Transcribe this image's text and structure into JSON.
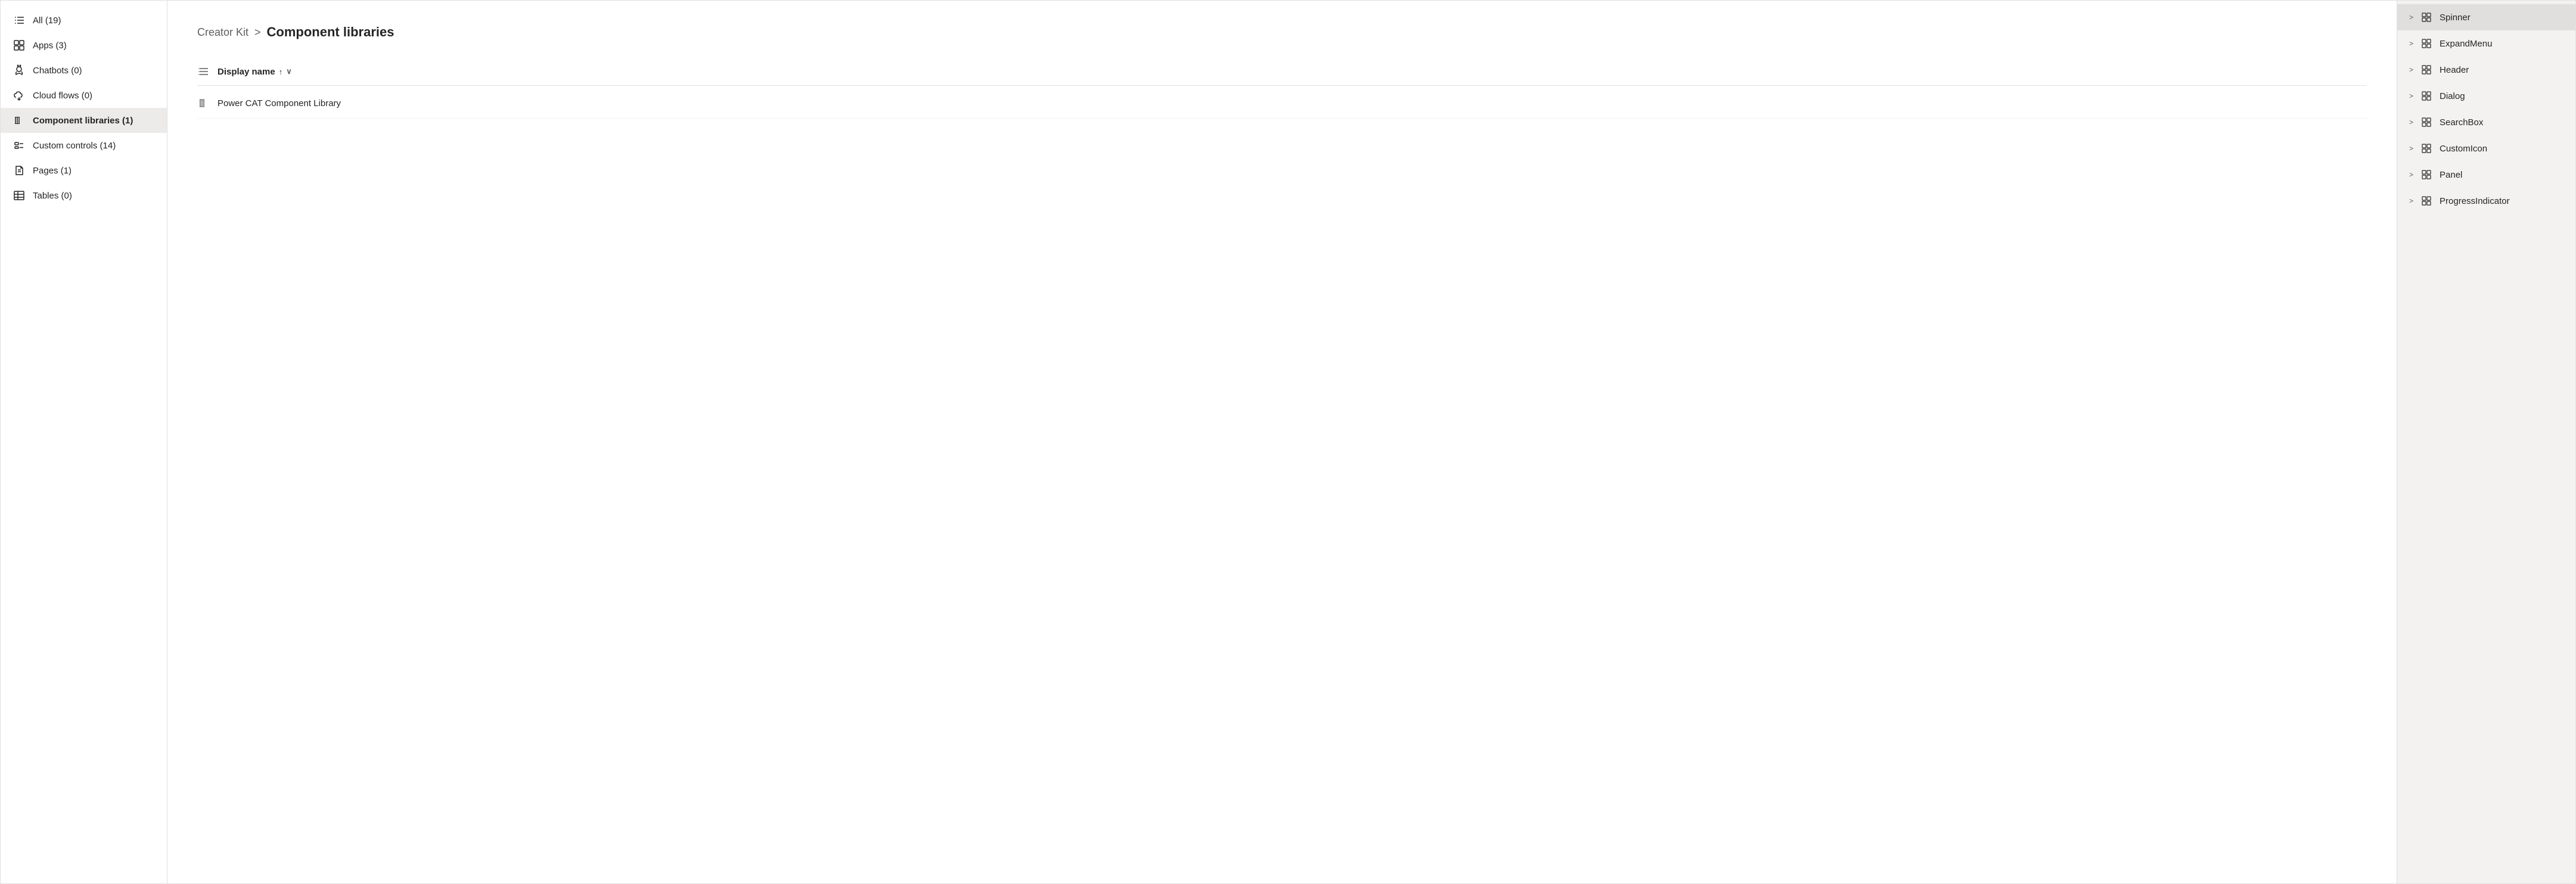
{
  "sidebar": {
    "items": [
      {
        "id": "all",
        "label": "All (19)",
        "icon": "list-icon",
        "active": false
      },
      {
        "id": "apps",
        "label": "Apps (3)",
        "icon": "apps-icon",
        "active": false
      },
      {
        "id": "chatbots",
        "label": "Chatbots (0)",
        "icon": "chatbots-icon",
        "active": false
      },
      {
        "id": "cloud-flows",
        "label": "Cloud flows (0)",
        "icon": "cloud-flows-icon",
        "active": false
      },
      {
        "id": "component-libraries",
        "label": "Component libraries (1)",
        "icon": "component-libraries-icon",
        "active": true
      },
      {
        "id": "custom-controls",
        "label": "Custom controls (14)",
        "icon": "custom-controls-icon",
        "active": false
      },
      {
        "id": "pages",
        "label": "Pages (1)",
        "icon": "pages-icon",
        "active": false
      },
      {
        "id": "tables",
        "label": "Tables (0)",
        "icon": "tables-icon",
        "active": false
      }
    ]
  },
  "main": {
    "breadcrumb": {
      "parent": "Creator Kit",
      "separator": ">",
      "current": "Component libraries"
    },
    "table": {
      "column_label": "Display name",
      "sort_up": "↑",
      "sort_down": "∨",
      "rows": [
        {
          "label": "Power CAT Component Library",
          "icon": "library-icon"
        }
      ]
    }
  },
  "right_sidebar": {
    "items": [
      {
        "id": "spinner",
        "label": "Spinner",
        "active": true
      },
      {
        "id": "expand-menu",
        "label": "ExpandMenu",
        "active": false
      },
      {
        "id": "header",
        "label": "Header",
        "active": false
      },
      {
        "id": "dialog",
        "label": "Dialog",
        "active": false
      },
      {
        "id": "search-box",
        "label": "SearchBox",
        "active": false
      },
      {
        "id": "custom-icon",
        "label": "CustomIcon",
        "active": false
      },
      {
        "id": "panel",
        "label": "Panel",
        "active": false
      },
      {
        "id": "progress-indicator",
        "label": "ProgressIndicator",
        "active": false
      }
    ]
  }
}
